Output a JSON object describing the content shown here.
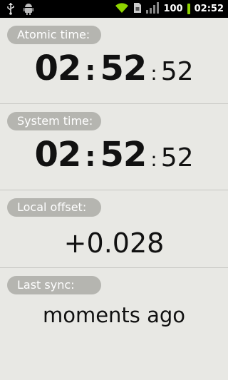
{
  "status_bar": {
    "icons_left": [
      "usb-icon",
      "android-icon"
    ],
    "icons_right": [
      "wifi-icon",
      "sim-icon",
      "signal-icon"
    ],
    "battery_level": "100",
    "battery_color": "#8fd400",
    "clock": "02:52"
  },
  "atomic": {
    "label": "Atomic time:",
    "hours": "02",
    "minutes": "52",
    "seconds": "52"
  },
  "system": {
    "label": "System time:",
    "hours": "02",
    "minutes": "52",
    "seconds": "52"
  },
  "offset": {
    "label": "Local offset:",
    "value": "+0.028"
  },
  "sync": {
    "label": "Last sync:",
    "value": "moments ago"
  },
  "colors": {
    "background": "#e8e8e4",
    "label_pill": "#b5b5b0"
  }
}
